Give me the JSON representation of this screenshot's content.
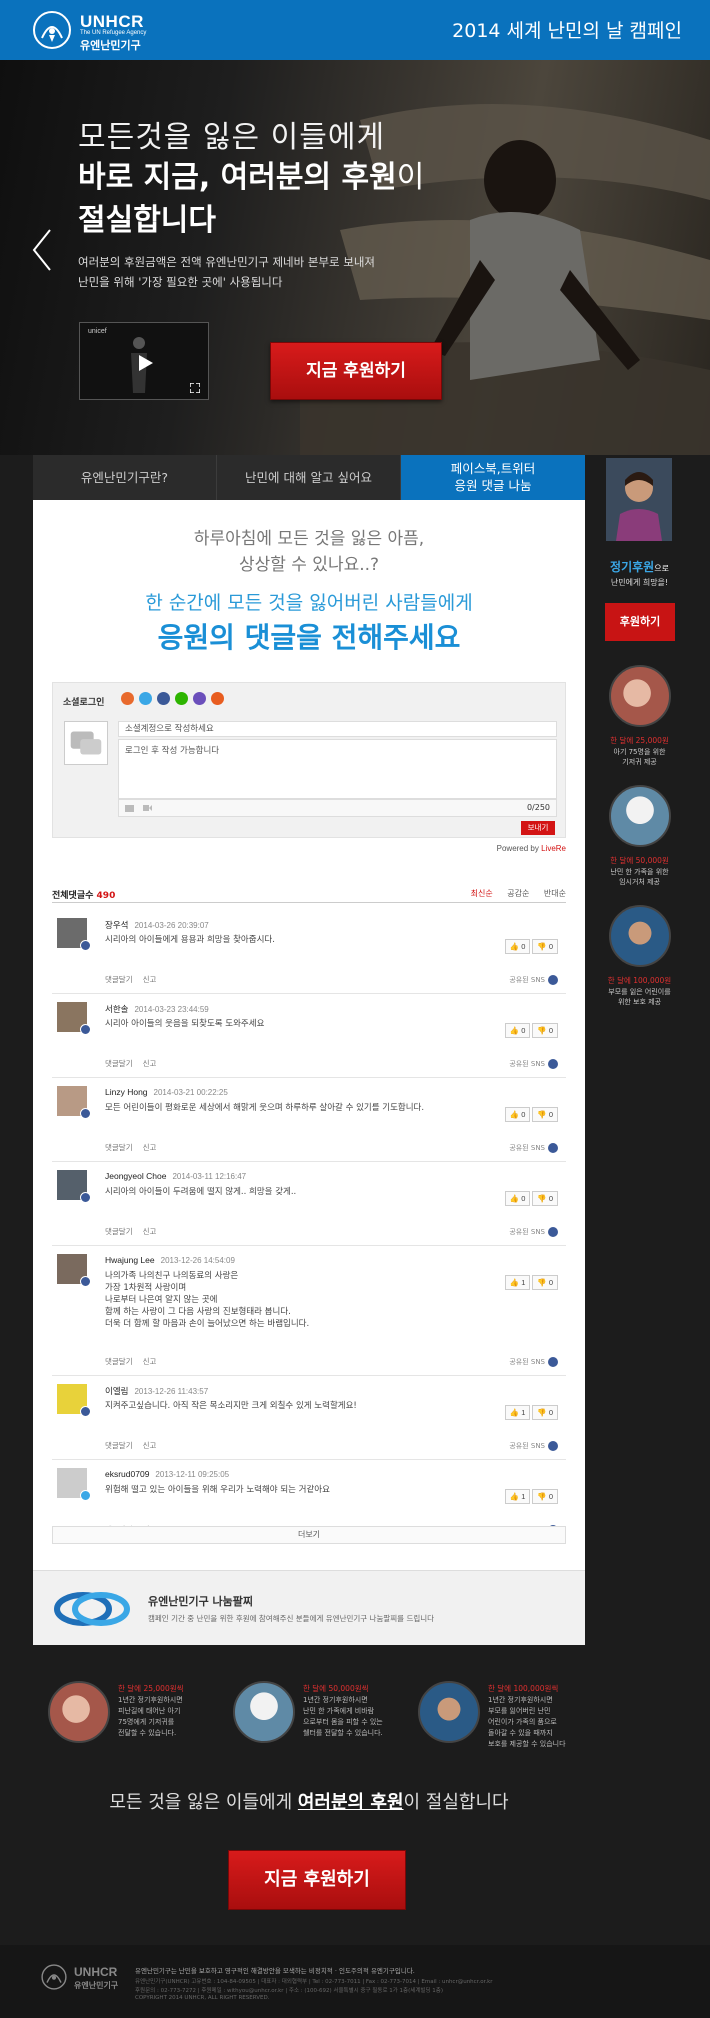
{
  "header": {
    "logo_name": "UNHCR",
    "logo_tagline": "The UN Refugee Agency",
    "logo_korean": "유엔난민기구",
    "campaign_title": "2014 세계 난민의 날 캠페인"
  },
  "hero": {
    "line1": "모든것을 잃은 이들에게",
    "line2_bold": "바로 지금, 여러분의 후원",
    "line2_light": "이",
    "line3": "절실합니다",
    "desc1": "여러분의 후원금액은 전액 유엔난민기구 제네바 본부로 보내져",
    "desc2": "난민을 위해 '가장 필요한 곳에' 사용됩니다",
    "video_label": "unicef",
    "cta": "지금 후원하기"
  },
  "tabs": [
    {
      "label": "유엔난민기구란?"
    },
    {
      "label": "난민에 대해 알고 싶어요"
    },
    {
      "label1": "페이스북,트위터",
      "label2": "응원 댓글 나눔"
    }
  ],
  "intro": {
    "line1": "하루아침에 모든 것을 잃은 아픔,",
    "line2": "상상할 수 있나요..?",
    "line3": "한 순간에 모든 것을 잃어버린 사람들에게",
    "line4": "응원의 댓글을 전해주세요"
  },
  "comment_box": {
    "social_label": "소셜로그인",
    "placeholder_top": "소셜계정으로 작성하세요",
    "placeholder_body": "로그인 후 작성 가능합니다",
    "count": "0/250",
    "submit": "보내기",
    "powered_prefix": "Powered by ",
    "powered_brand": "LiveRe"
  },
  "comments_header": {
    "total_label": "전체댓글수",
    "total_count": "490",
    "sort_latest": "최신순",
    "sort_likes": "공감순",
    "sort_dislikes": "반대순"
  },
  "comments": [
    {
      "name": "장우석",
      "date": "2014-03-26 20:39:07",
      "text": "시리아의 아이들에게 용용과 희망을 찾아줍시다.",
      "likes": "0",
      "dislikes": "0",
      "reply": "댓글달기",
      "report": "신고",
      "share": "공유된 SNS"
    },
    {
      "name": "서한솔",
      "date": "2014-03-23 23:44:59",
      "text": "시리아 아이들의 웃음을 되찾도록 도와주세요",
      "likes": "0",
      "dislikes": "0",
      "reply": "댓글달기",
      "report": "신고",
      "share": "공유된 SNS"
    },
    {
      "name": "Linzy Hong",
      "date": "2014-03-21 00:22:25",
      "text": "모든 어린이들이 평화로운 세상에서 해맑게 웃으며 하루하루 살아갈 수 있기를 기도합니다.",
      "likes": "0",
      "dislikes": "0",
      "reply": "댓글달기",
      "report": "신고",
      "share": "공유된 SNS"
    },
    {
      "name": "Jeongyeol Choe",
      "date": "2014-03-11 12:16:47",
      "text": "시리아의 아이들이 두려움에 떨지 않게.. 희망을 갖게..",
      "likes": "0",
      "dislikes": "0",
      "reply": "댓글달기",
      "report": "신고",
      "share": "공유된 SNS"
    },
    {
      "name": "Hwajung Lee",
      "date": "2013-12-26 14:54:09",
      "text": "나의가족 나의친구 나의동료의 사랑은\n가장 1차원적 사랑이며\n나로부터 나은여 알지 않는 곳에\n함께 하는 사랑이 그 다음 사랑의 진보형태라 봅니다.\n더욱 더 함께 할 마음과 손이 늘어났으면 하는 바램입니다.",
      "likes": "1",
      "dislikes": "0",
      "reply": "댓글달기",
      "report": "신고",
      "share": "공유된 SNS"
    },
    {
      "name": "이엘림",
      "date": "2013-12-26 11:43:57",
      "text": "지켜주고싶습니다. 아직 작은 목소리지만 크게 외칠수 있게 노력할게요!",
      "likes": "1",
      "dislikes": "0",
      "reply": "댓글달기",
      "report": "신고",
      "share": "공유된 SNS"
    },
    {
      "name": "eksrud0709",
      "date": "2013-12-11 09:25:05",
      "text": "위험해 떨고 있는 아이들을 위해 우리가 노력해야 되는 거같아요",
      "likes": "1",
      "dislikes": "0",
      "reply": "댓글달기",
      "report": "신고",
      "share": "공유된 SNS"
    }
  ],
  "more_label": "더보기",
  "band": {
    "title": "유엔난민기구 나눔팔찌",
    "desc": "캠페인 기간 중 난민을 위한 후원에 참여해주신 분들에게 유엔난민기구 나눔팔찌를 드립니다"
  },
  "sidebar": {
    "title_bold": "정기후원",
    "title_suffix": "으로",
    "subtitle": "난민에게 희망을!",
    "button": "후원하기",
    "items": [
      {
        "amount": "한 달에 25,000원",
        "desc": "아기 75명을 위한\n기저귀 제공"
      },
      {
        "amount": "한 달에 50,000원",
        "desc": "난민 한 가족을 위한\n임시거처 제공"
      },
      {
        "amount": "한 달에 100,000원",
        "desc": "부모를 잃은 어린이를\n위한 보호 제공"
      }
    ]
  },
  "lower": {
    "items": [
      {
        "amount": "한 달에 25,000원씩",
        "desc": "1년간 정기후원하시면\n피난길에 태어난 아기\n75명에게 기저귀를\n전달할 수 있습니다."
      },
      {
        "amount": "한 달에 50,000원씩",
        "desc": "1년간 정기후원하시면\n난민 한 가족에게 비바람\n으로부터 몸을 피할 수 있는\n쉘터를 전달할 수 있습니다."
      },
      {
        "amount": "한 달에 100,000원씩",
        "desc": "1년간 정기후원하시면\n부모를 잃어버린 난민\n어린이가 가족의 품으로\n돌아갈 수 있을 때까지\n보호를 제공할 수 있습니다"
      }
    ],
    "slogan_pre": "모든 것을 잃은 이들에게 ",
    "slogan_bold": "여러분의 후원",
    "slogan_post": "이 절실합니다",
    "cta": "지금 후원하기"
  },
  "footer": {
    "logo_name": "UNHCR",
    "logo_korean": "유엔난민기구",
    "line1": "유엔난민기구는 난민을 보호하고 영구적인 해결방안을 모색하는 비정치적 · 인도주의적 유엔기구입니다.",
    "line2": "유엔난민기구(UNHCR) 고유번호 : 104-84-09505  |  대표자 : 대외협력부  |  Tel : 02-773-7011  |  Fax : 02-773-7014  |  Email : unhcr@unhcr.or.kr",
    "line3": "후원문의 : 02-773-7272  |  후원메일 : withyou@unhcr.or.kr  |  주소 : (100-692) 서울특별시 중구 필동로 1가 1층(세계빌딩 1층)",
    "line4": "COPYRIGHT 2014 UNHCR, ALL RIGHT RESERVED."
  }
}
